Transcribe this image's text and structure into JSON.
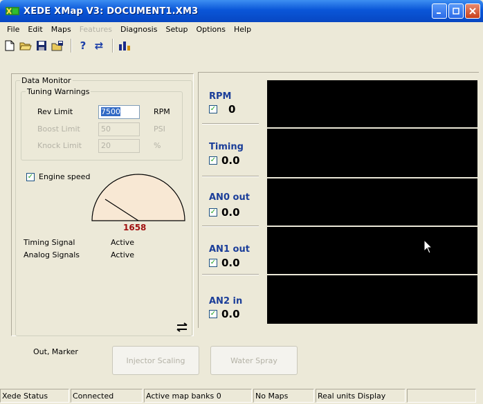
{
  "window": {
    "title": "XEDE XMap V3: DOCUMENT1.XM3",
    "controls": [
      "minimize",
      "maximize",
      "close"
    ]
  },
  "menu": {
    "items": [
      {
        "label": "File",
        "enabled": true
      },
      {
        "label": "Edit",
        "enabled": true
      },
      {
        "label": "Maps",
        "enabled": true
      },
      {
        "label": "Features",
        "enabled": false
      },
      {
        "label": "Diagnosis",
        "enabled": true
      },
      {
        "label": "Setup",
        "enabled": true
      },
      {
        "label": "Options",
        "enabled": true
      },
      {
        "label": "Help",
        "enabled": true
      }
    ]
  },
  "toolbar": {
    "icons": [
      "new-document-icon",
      "open-folder-icon",
      "save-icon",
      "save-all-icon",
      "help-icon",
      "transfer-icon",
      "chart-icon"
    ],
    "help_glyph": "?",
    "transfer_glyph": "⇄"
  },
  "data_monitor": {
    "title": "Data Monitor",
    "tuning_warnings": {
      "title": "Tuning Warnings",
      "rows": [
        {
          "label": "Rev Limit",
          "value": "7500",
          "unit": "RPM",
          "enabled": true
        },
        {
          "label": "Boost Limit",
          "value": "50",
          "unit": "PSI",
          "enabled": false
        },
        {
          "label": "Knock Limit",
          "value": "20",
          "unit": "%",
          "enabled": false
        }
      ]
    },
    "engine_speed": {
      "label": "Engine speed",
      "checked": true,
      "value": "1658"
    },
    "signals": [
      {
        "label": "Timing Signal",
        "status": "Active"
      },
      {
        "label": "Analog Signals",
        "status": "Active"
      }
    ]
  },
  "channels": [
    {
      "name": "RPM",
      "checked": true,
      "value": "0"
    },
    {
      "name": "Timing",
      "checked": true,
      "value": "0.0"
    },
    {
      "name": "AN0 out",
      "checked": true,
      "value": "0.0"
    },
    {
      "name": "AN1 out",
      "checked": true,
      "value": "0.0"
    },
    {
      "name": "AN2 in",
      "checked": true,
      "value": "0.0"
    }
  ],
  "bottom": {
    "label": "Out, Marker",
    "buttons": [
      {
        "label": "Injector Scaling",
        "enabled": false
      },
      {
        "label": "Water Spray",
        "enabled": false
      }
    ]
  },
  "status_bar": {
    "cells": [
      "Xede Status",
      "Connected",
      "Active map banks 0",
      "No Maps",
      "Real units Display",
      ""
    ]
  },
  "colors": {
    "title_bar": "#0a56d8",
    "channel_label": "#1b3e99",
    "gauge_value": "#a01010",
    "scope_bg": "#000000",
    "gauge_fill": "#f8e8d4"
  }
}
